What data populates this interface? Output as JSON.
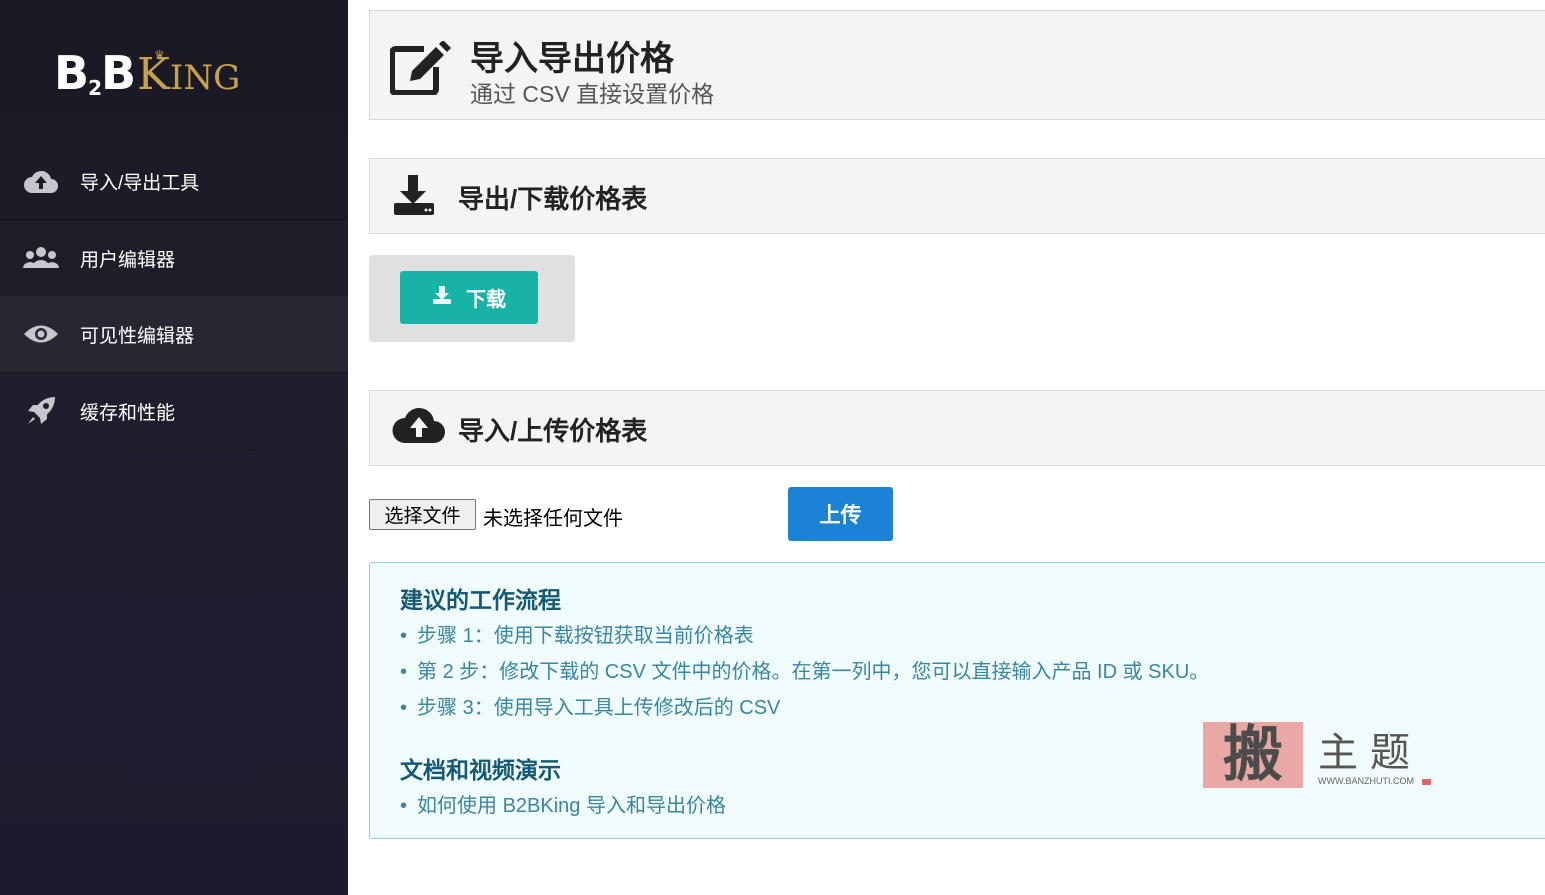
{
  "brand": {
    "logo_b2b": "B",
    "logo_two": "2",
    "logo_b": "B",
    "logo_k": "K",
    "logo_ing": "ING"
  },
  "sidebar": {
    "items": [
      {
        "label": "导入/导出工具",
        "icon": "cloud-upload-icon"
      },
      {
        "label": "用户编辑器",
        "icon": "users-icon"
      },
      {
        "label": "可见性编辑器",
        "icon": "eye-icon"
      },
      {
        "label": "缓存和性能",
        "icon": "rocket-icon"
      }
    ]
  },
  "header": {
    "title": "导入导出价格",
    "subtitle": "通过 CSV 直接设置价格",
    "icon": "edit-icon"
  },
  "export_section": {
    "title": "导出/下载价格表",
    "icon": "download-icon",
    "button_label": "下载"
  },
  "import_section": {
    "title": "导入/上传价格表",
    "icon": "cloud-upload-icon",
    "file_button_label": "选择文件",
    "file_status": "未选择任何文件",
    "upload_label": "上传"
  },
  "info": {
    "workflow_title": "建议的工作流程",
    "steps": [
      "步骤 1：使用下载按钮获取当前价格表",
      "第 2 步：修改下载的 CSV 文件中的价格。在第一列中，您可以直接输入产品 ID 或 SKU。",
      "步骤 3：使用导入工具上传修改后的 CSV"
    ],
    "docs_title": "文档和视频演示",
    "docs": [
      "如何使用 B2BKing 导入和导出价格"
    ]
  },
  "watermark": {
    "stamp": "搬",
    "text": "主题",
    "url": "WWW.BANZHUTI.COM"
  },
  "colors": {
    "sidebar_bg": "#1d1d2e",
    "teal_button": "#17b3a6",
    "blue_button": "#1c82d4",
    "info_title": "#155a72",
    "info_text": "#3a86a0"
  }
}
